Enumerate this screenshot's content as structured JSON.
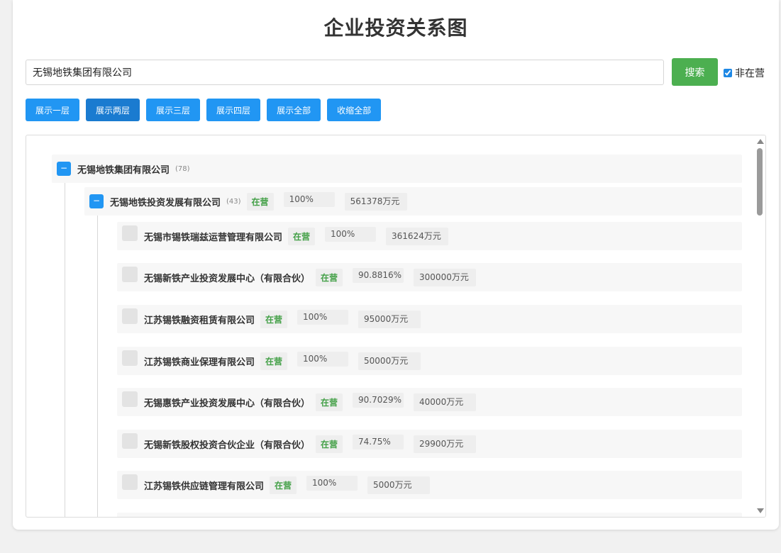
{
  "title": "企业投资关系图",
  "search": {
    "value": "无锡地铁集团有限公司",
    "button": "搜索"
  },
  "filter": {
    "label": "非在营",
    "checked": true
  },
  "toolbar": [
    "展示一层",
    "展示两层",
    "展示三层",
    "展示四层",
    "展示全部",
    "收缩全部"
  ],
  "toolbar_active": "展示两层",
  "tree": {
    "root": {
      "name": "无锡地铁集团有限公司",
      "count": "(78)",
      "toggle": "−"
    },
    "level1": {
      "name": "无锡地铁投资发展有限公司",
      "count": "(43)",
      "status": "在营",
      "percent": "100%",
      "capital": "561378万元",
      "toggle": "−"
    },
    "children": [
      {
        "name": "无锡市锡铁瑞兹运营管理有限公司",
        "status": "在营",
        "percent": "100%",
        "capital": "361624万元"
      },
      {
        "name": "无锡新铁产业投资发展中心（有限合伙）",
        "status": "在营",
        "percent": "90.8816%",
        "capital": "300000万元"
      },
      {
        "name": "江苏锡铁融资租赁有限公司",
        "status": "在营",
        "percent": "100%",
        "capital": "95000万元"
      },
      {
        "name": "江苏锡铁商业保理有限公司",
        "status": "在营",
        "percent": "100%",
        "capital": "50000万元"
      },
      {
        "name": "无锡惠铁产业投资发展中心（有限合伙）",
        "status": "在营",
        "percent": "90.7029%",
        "capital": "40000万元"
      },
      {
        "name": "无锡新铁股权投资合伙企业（有限合伙）",
        "status": "在营",
        "percent": "74.75%",
        "capital": "29900万元"
      },
      {
        "name": "江苏锡铁供应链管理有限公司",
        "status": "在营",
        "percent": "100%",
        "capital": "5000万元"
      }
    ]
  },
  "colors": {
    "primary": "#2196f3",
    "success": "#4caf50",
    "status": "#43a047"
  }
}
